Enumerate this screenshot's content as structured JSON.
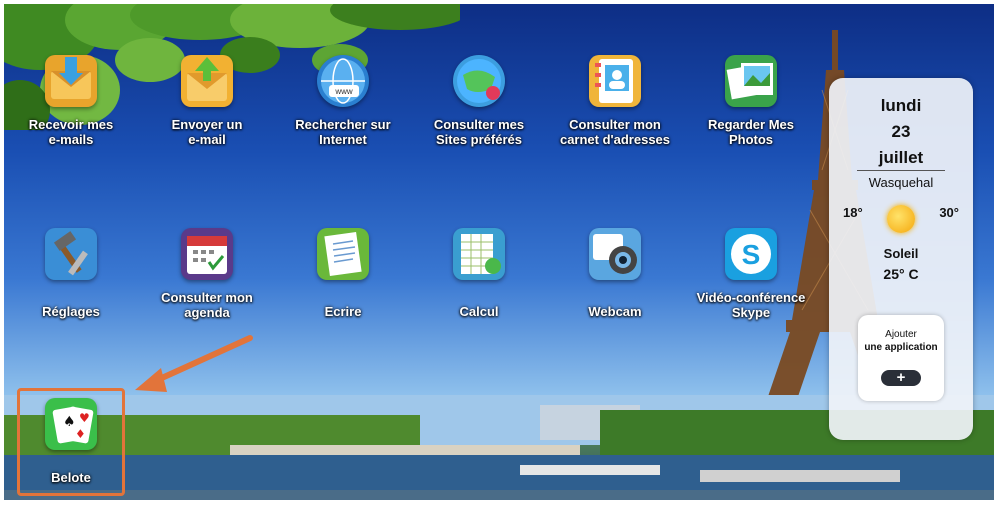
{
  "apps": [
    {
      "label": "Recevoir mes\ne-mails",
      "icon": "envelope-receive-icon"
    },
    {
      "label": "Envoyer un\ne-mail",
      "icon": "envelope-send-icon"
    },
    {
      "label": "Rechercher sur\nInternet",
      "icon": "globe-www-icon"
    },
    {
      "label": "Consulter mes\nSites préférés",
      "icon": "favorites-globe-icon"
    },
    {
      "label": "Consulter mon\ncarnet d'adresses",
      "icon": "address-book-icon"
    },
    {
      "label": "Regarder Mes\nPhotos",
      "icon": "photos-icon"
    },
    {
      "label": "Réglages",
      "icon": "tools-icon"
    },
    {
      "label": "Consulter mon\nagenda",
      "icon": "calendar-icon"
    },
    {
      "label": "Ecrire",
      "icon": "document-write-icon"
    },
    {
      "label": "Calcul",
      "icon": "spreadsheet-icon"
    },
    {
      "label": "Webcam",
      "icon": "webcam-icon"
    },
    {
      "label": "Vidéo-conférence\nSkype",
      "icon": "skype-icon"
    },
    {
      "label": "Belote",
      "icon": "playing-cards-icon"
    }
  ],
  "weather": {
    "day": "lundi",
    "date": "23",
    "month": "juillet",
    "city": "Wasquehal",
    "min": "18°",
    "max": "30°",
    "condition": "Soleil",
    "temperature": "25° C",
    "icon": "sun-icon"
  },
  "add_app": {
    "line1": "Ajouter",
    "line2": "une application",
    "button": "+"
  },
  "colors": {
    "highlight": "#e2743a"
  }
}
